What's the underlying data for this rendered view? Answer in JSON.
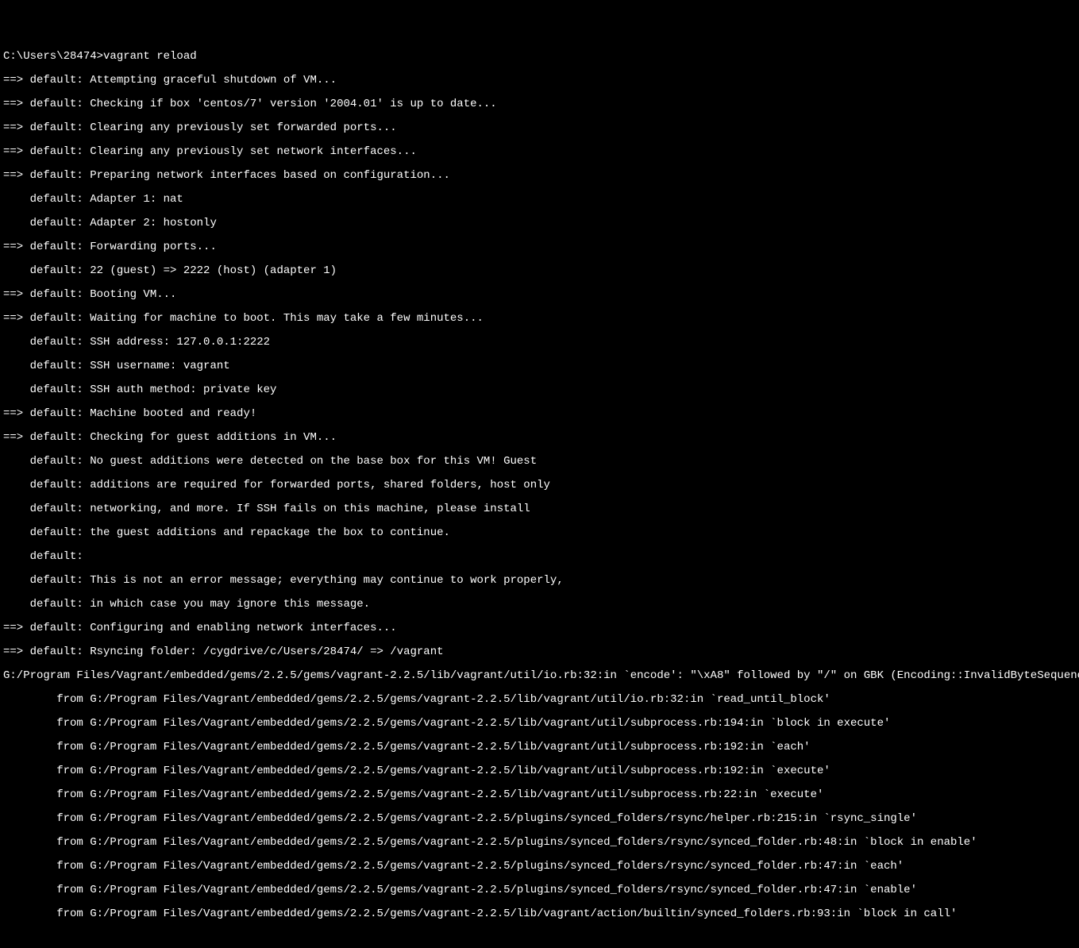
{
  "prompt": "C:\\Users\\28474>vagrant reload",
  "lines": [
    "==> default: Attempting graceful shutdown of VM...",
    "==> default: Checking if box 'centos/7' version '2004.01' is up to date...",
    "==> default: Clearing any previously set forwarded ports...",
    "==> default: Clearing any previously set network interfaces...",
    "==> default: Preparing network interfaces based on configuration...",
    "    default: Adapter 1: nat",
    "    default: Adapter 2: hostonly",
    "==> default: Forwarding ports...",
    "    default: 22 (guest) => 2222 (host) (adapter 1)",
    "==> default: Booting VM...",
    "==> default: Waiting for machine to boot. This may take a few minutes...",
    "    default: SSH address: 127.0.0.1:2222",
    "    default: SSH username: vagrant",
    "    default: SSH auth method: private key",
    "==> default: Machine booted and ready!",
    "==> default: Checking for guest additions in VM...",
    "    default: No guest additions were detected on the base box for this VM! Guest",
    "    default: additions are required for forwarded ports, shared folders, host only",
    "    default: networking, and more. If SSH fails on this machine, please install",
    "    default: the guest additions and repackage the box to continue.",
    "    default:",
    "    default: This is not an error message; everything may continue to work properly,",
    "    default: in which case you may ignore this message.",
    "==> default: Configuring and enabling network interfaces...",
    "==> default: Rsyncing folder: /cygdrive/c/Users/28474/ => /vagrant",
    "G:/Program Files/Vagrant/embedded/gems/2.2.5/gems/vagrant-2.2.5/lib/vagrant/util/io.rb:32:in `encode': \"\\xA8\" followed by \"/\" on GBK (Encoding::InvalidByteSequenceError)",
    "        from G:/Program Files/Vagrant/embedded/gems/2.2.5/gems/vagrant-2.2.5/lib/vagrant/util/io.rb:32:in `read_until_block'",
    "        from G:/Program Files/Vagrant/embedded/gems/2.2.5/gems/vagrant-2.2.5/lib/vagrant/util/subprocess.rb:194:in `block in execute'",
    "        from G:/Program Files/Vagrant/embedded/gems/2.2.5/gems/vagrant-2.2.5/lib/vagrant/util/subprocess.rb:192:in `each'",
    "        from G:/Program Files/Vagrant/embedded/gems/2.2.5/gems/vagrant-2.2.5/lib/vagrant/util/subprocess.rb:192:in `execute'",
    "        from G:/Program Files/Vagrant/embedded/gems/2.2.5/gems/vagrant-2.2.5/lib/vagrant/util/subprocess.rb:22:in `execute'",
    "        from G:/Program Files/Vagrant/embedded/gems/2.2.5/gems/vagrant-2.2.5/plugins/synced_folders/rsync/helper.rb:215:in `rsync_single'",
    "        from G:/Program Files/Vagrant/embedded/gems/2.2.5/gems/vagrant-2.2.5/plugins/synced_folders/rsync/synced_folder.rb:48:in `block in enable'",
    "        from G:/Program Files/Vagrant/embedded/gems/2.2.5/gems/vagrant-2.2.5/plugins/synced_folders/rsync/synced_folder.rb:47:in `each'",
    "        from G:/Program Files/Vagrant/embedded/gems/2.2.5/gems/vagrant-2.2.5/plugins/synced_folders/rsync/synced_folder.rb:47:in `enable'",
    "        from G:/Program Files/Vagrant/embedded/gems/2.2.5/gems/vagrant-2.2.5/lib/vagrant/action/builtin/synced_folders.rb:93:in `block in call'"
  ]
}
